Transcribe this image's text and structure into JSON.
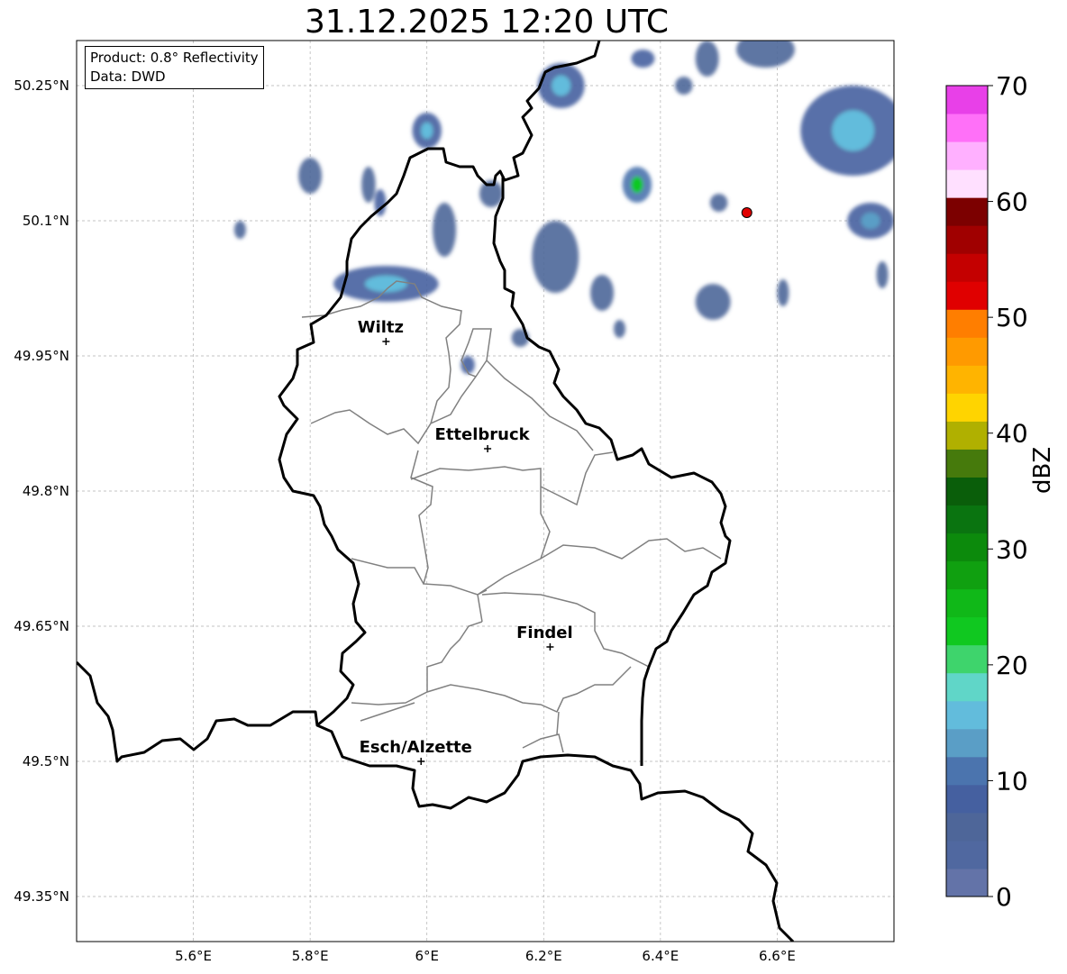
{
  "title": "31.12.2025 12:20 UTC",
  "info": {
    "product": "Product: 0.8° Reflectivity",
    "data": "Data: DWD"
  },
  "map": {
    "lon_range": [
      5.4,
      6.8
    ],
    "lat_range": [
      49.3,
      50.3
    ],
    "lat_ticks": [
      {
        "value": 50.25,
        "label": "50.25°N"
      },
      {
        "value": 50.1,
        "label": "50.1°N"
      },
      {
        "value": 49.95,
        "label": "49.95°N"
      },
      {
        "value": 49.8,
        "label": "49.8°N"
      },
      {
        "value": 49.65,
        "label": "49.65°N"
      },
      {
        "value": 49.5,
        "label": "49.5°N"
      },
      {
        "value": 49.35,
        "label": "49.35°N"
      }
    ],
    "lon_ticks": [
      {
        "value": 5.6,
        "label": "5.6°E"
      },
      {
        "value": 5.8,
        "label": "5.8°E"
      },
      {
        "value": 6.0,
        "label": "6°E"
      },
      {
        "value": 6.2,
        "label": "6.2°E"
      },
      {
        "value": 6.4,
        "label": "6.4°E"
      },
      {
        "value": 6.6,
        "label": "6.6°E"
      }
    ],
    "cities": [
      {
        "name": "Wiltz",
        "lon": 5.93,
        "lat": 49.966
      },
      {
        "name": "Ettelbruck",
        "lon": 6.104,
        "lat": 49.847
      },
      {
        "name": "Findel",
        "lon": 6.211,
        "lat": 49.627
      },
      {
        "name": "Esch/Alzette",
        "lon": 5.99,
        "lat": 49.5
      }
    ],
    "radar_site": {
      "lon": 6.548,
      "lat": 50.109,
      "color": "#e00000"
    },
    "echoes": [
      {
        "lon": 5.93,
        "lat": 50.03,
        "rlon": 0.09,
        "rlat": 0.02,
        "dbz": 8,
        "core": 17
      },
      {
        "lon": 6.0,
        "lat": 50.2,
        "rlon": 0.025,
        "rlat": 0.02,
        "dbz": 8,
        "core": 16
      },
      {
        "lon": 5.68,
        "lat": 50.09,
        "rlon": 0.01,
        "rlat": 0.01,
        "dbz": 6
      },
      {
        "lon": 5.8,
        "lat": 50.15,
        "rlon": 0.02,
        "rlat": 0.02,
        "dbz": 7
      },
      {
        "lon": 5.9,
        "lat": 50.14,
        "rlon": 0.012,
        "rlat": 0.02,
        "dbz": 7
      },
      {
        "lon": 5.92,
        "lat": 50.12,
        "rlon": 0.01,
        "rlat": 0.015,
        "dbz": 8
      },
      {
        "lon": 6.03,
        "lat": 50.09,
        "rlon": 0.02,
        "rlat": 0.03,
        "dbz": 7
      },
      {
        "lon": 6.11,
        "lat": 50.13,
        "rlon": 0.02,
        "rlat": 0.015,
        "dbz": 7
      },
      {
        "lon": 6.23,
        "lat": 50.25,
        "rlon": 0.04,
        "rlat": 0.025,
        "dbz": 8,
        "core": 15
      },
      {
        "lon": 6.37,
        "lat": 50.28,
        "rlon": 0.02,
        "rlat": 0.01,
        "dbz": 9
      },
      {
        "lon": 6.36,
        "lat": 50.14,
        "rlon": 0.025,
        "rlat": 0.02,
        "dbz": 10,
        "core": 23
      },
      {
        "lon": 6.44,
        "lat": 50.25,
        "rlon": 0.015,
        "rlat": 0.01,
        "dbz": 7
      },
      {
        "lon": 6.48,
        "lat": 50.28,
        "rlon": 0.02,
        "rlat": 0.02,
        "dbz": 7
      },
      {
        "lon": 6.58,
        "lat": 50.29,
        "rlon": 0.05,
        "rlat": 0.02,
        "dbz": 7
      },
      {
        "lon": 6.73,
        "lat": 50.2,
        "rlon": 0.09,
        "rlat": 0.05,
        "dbz": 9,
        "core": 16
      },
      {
        "lon": 6.76,
        "lat": 50.1,
        "rlon": 0.04,
        "rlat": 0.02,
        "dbz": 8,
        "core": 14
      },
      {
        "lon": 6.22,
        "lat": 50.06,
        "rlon": 0.04,
        "rlat": 0.04,
        "dbz": 7
      },
      {
        "lon": 6.3,
        "lat": 50.02,
        "rlon": 0.02,
        "rlat": 0.02,
        "dbz": 7
      },
      {
        "lon": 6.49,
        "lat": 50.01,
        "rlon": 0.03,
        "rlat": 0.02,
        "dbz": 6
      },
      {
        "lon": 6.5,
        "lat": 50.12,
        "rlon": 0.015,
        "rlat": 0.01,
        "dbz": 6
      },
      {
        "lon": 6.61,
        "lat": 50.02,
        "rlon": 0.01,
        "rlat": 0.015,
        "dbz": 6
      },
      {
        "lon": 6.78,
        "lat": 50.04,
        "rlon": 0.01,
        "rlat": 0.015,
        "dbz": 6
      },
      {
        "lon": 6.07,
        "lat": 49.94,
        "rlon": 0.012,
        "rlat": 0.01,
        "dbz": 9
      },
      {
        "lon": 6.16,
        "lat": 49.97,
        "rlon": 0.015,
        "rlat": 0.01,
        "dbz": 7
      },
      {
        "lon": 6.33,
        "lat": 49.98,
        "rlon": 0.01,
        "rlat": 0.01,
        "dbz": 7
      }
    ]
  },
  "colorbar": {
    "label": "dBZ",
    "min": 0,
    "max": 70,
    "step": 2.5,
    "tick_labels": [
      "0",
      "10",
      "20",
      "30",
      "40",
      "50",
      "60",
      "70"
    ],
    "colors": [
      "#6373a8",
      "#5068a0",
      "#4e6699",
      "#4560a0",
      "#4b74ae",
      "#5a9ec6",
      "#62bcdc",
      "#60d6c8",
      "#3ed46c",
      "#10c820",
      "#10b818",
      "#10a010",
      "#0c8a0c",
      "#0a7410",
      "#0a5e0a",
      "#467a0c",
      "#b0b000",
      "#ffd400",
      "#ffb400",
      "#ff9a00",
      "#ff7e00",
      "#e00000",
      "#c40000",
      "#a00000",
      "#7c0000",
      "#ffe0ff",
      "#ffb0ff",
      "#ff70f8",
      "#e840e8"
    ]
  }
}
